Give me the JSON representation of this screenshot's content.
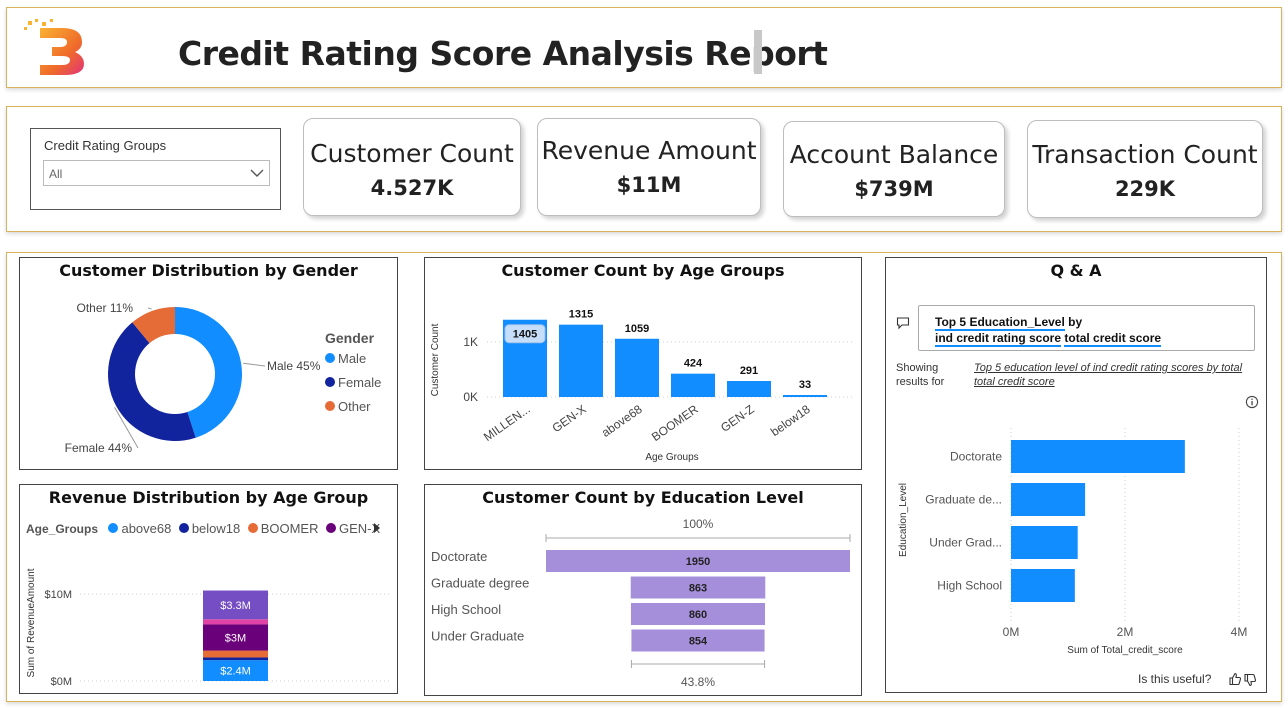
{
  "header": {
    "title": "Credit Rating Score Analysis Report"
  },
  "filter": {
    "label": "Credit Rating Groups",
    "value": "All"
  },
  "kpis": [
    {
      "label": "Customer Count",
      "value": "4.527K"
    },
    {
      "label": "Revenue Amount",
      "value": "$11M"
    },
    {
      "label": "Account Balance",
      "value": "$739M"
    },
    {
      "label": "Transaction Count",
      "value": "229K"
    }
  ],
  "colors": {
    "blue": "#118DFF",
    "navy": "#12239E",
    "orange": "#E66C37",
    "purple": "#6B007B",
    "violet": "#744EC2",
    "pink": "#E044A7",
    "funnel": "#A58FDB",
    "accent": "#D9B35A"
  },
  "gender_chart": {
    "title": "Customer Distribution by Gender",
    "legend_title": "Gender",
    "chart_data": {
      "type": "pie",
      "slices": [
        {
          "name": "Male",
          "value": 45,
          "label": "Male 45%"
        },
        {
          "name": "Female",
          "value": 44,
          "label": "Female 44%"
        },
        {
          "name": "Other",
          "value": 11,
          "label": "Other 11%"
        }
      ]
    }
  },
  "age_chart": {
    "title": "Customer Count by Age Groups",
    "chart_data": {
      "type": "bar",
      "categories": [
        "MILLEN...",
        "GEN-X",
        "above68",
        "BOOMER",
        "GEN-Z",
        "below18"
      ],
      "values": [
        1405,
        1315,
        1059,
        424,
        291,
        33
      ],
      "xlabel": "Age Groups",
      "ylabel": "Customer Count",
      "yticks": [
        "0K",
        "1K"
      ],
      "ylim": [
        0,
        1500
      ]
    }
  },
  "revenue_chart": {
    "title": "Revenue Distribution by Age Group",
    "legend_title": "Age_Groups",
    "legend": [
      "above68",
      "below18",
      "BOOMER",
      "GEN-X"
    ],
    "chart_data": {
      "type": "bar",
      "stacked": true,
      "ylabel": "Sum of RevenueAmount",
      "yticks": [
        "$0M",
        "$10M"
      ],
      "ylim": [
        0,
        11
      ],
      "series": [
        {
          "name": "above68",
          "value": 2.4,
          "label": "$2.4M"
        },
        {
          "name": "below18",
          "value": 0.3
        },
        {
          "name": "BOOMER",
          "value": 0.8
        },
        {
          "name": "GEN-X",
          "value": 3.0,
          "label": "$3M"
        },
        {
          "value": 0.6
        },
        {
          "value": 3.3,
          "label": "$3.3M"
        }
      ]
    }
  },
  "education_chart": {
    "title": "Customer Count by Education Level",
    "top_pct": "100%",
    "bottom_pct": "43.8%",
    "chart_data": {
      "type": "bar",
      "categories": [
        "Doctorate",
        "Graduate degree",
        "High School",
        "Under Graduate"
      ],
      "values": [
        1950,
        863,
        860,
        854
      ]
    }
  },
  "qa": {
    "title": "Q & A",
    "query_line1_a": "Top 5 Education_Level",
    "query_line1_b": " by",
    "query_line2_a": "ind credit rating score",
    "query_line2_b": "total credit score",
    "showing_label": "Showing results for",
    "showing_text": "Top 5 education level of ind credit rating scores by total total credit score",
    "useful_label": "Is this useful?",
    "chart_data": {
      "type": "bar",
      "orientation": "horizontal",
      "categories": [
        "Doctorate",
        "Graduate de...",
        "Under Grad...",
        "High School"
      ],
      "values": [
        3.05,
        1.3,
        1.17,
        1.12
      ],
      "xlabel": "Sum of Total_credit_score",
      "ylabel": "Education_Level",
      "xticks": [
        "0M",
        "2M",
        "4M"
      ],
      "xlim": [
        0,
        4
      ]
    }
  }
}
